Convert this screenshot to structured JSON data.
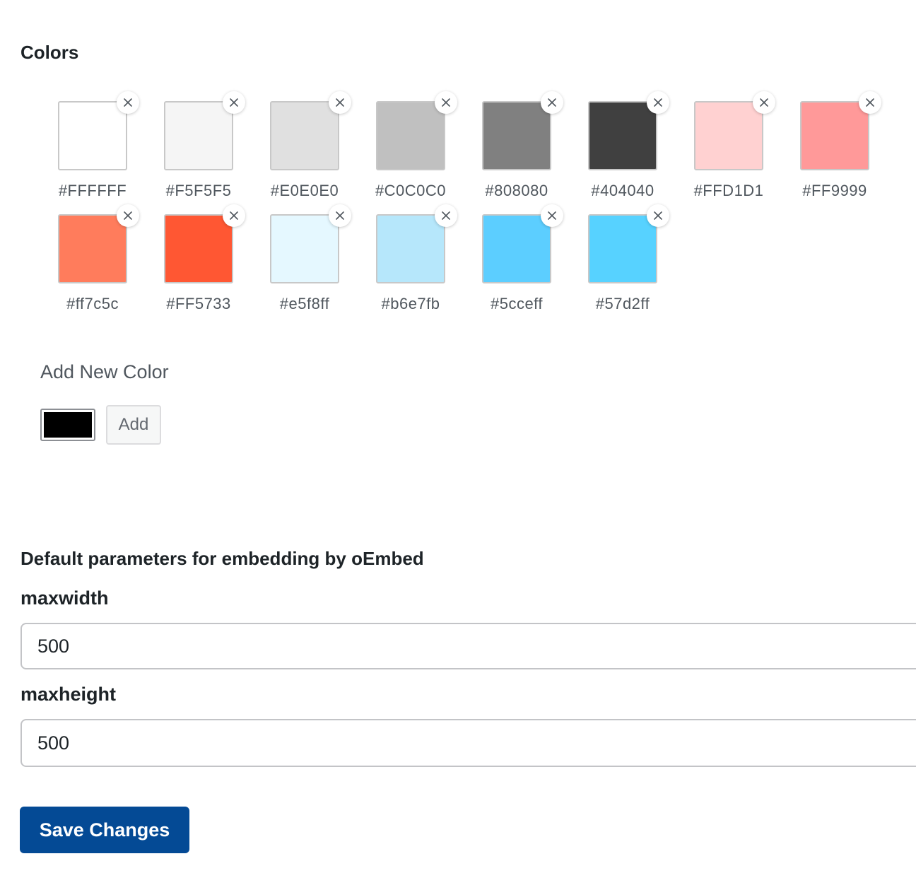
{
  "colors_section": {
    "title": "Colors",
    "swatches": [
      {
        "hex": "#FFFFFF",
        "label": "#FFFFFF"
      },
      {
        "hex": "#F5F5F5",
        "label": "#F5F5F5"
      },
      {
        "hex": "#E0E0E0",
        "label": "#E0E0E0"
      },
      {
        "hex": "#C0C0C0",
        "label": "#C0C0C0"
      },
      {
        "hex": "#808080",
        "label": "#808080"
      },
      {
        "hex": "#404040",
        "label": "#404040"
      },
      {
        "hex": "#FFD1D1",
        "label": "#FFD1D1"
      },
      {
        "hex": "#FF9999",
        "label": "#FF9999"
      },
      {
        "hex": "#ff7c5c",
        "label": "#ff7c5c"
      },
      {
        "hex": "#FF5733",
        "label": "#FF5733"
      },
      {
        "hex": "#e5f8ff",
        "label": "#e5f8ff"
      },
      {
        "hex": "#b6e7fb",
        "label": "#b6e7fb"
      },
      {
        "hex": "#5cceff",
        "label": "#5cceff"
      },
      {
        "hex": "#57d2ff",
        "label": "#57d2ff"
      }
    ],
    "remove_icon": "close-icon"
  },
  "add_color": {
    "title": "Add New Color",
    "picker_value": "#000000",
    "add_label": "Add"
  },
  "oembed_section": {
    "title": "Default parameters for embedding by oEmbed",
    "maxwidth_label": "maxwidth",
    "maxwidth_value": "500",
    "maxheight_label": "maxheight",
    "maxheight_value": "500"
  },
  "save_label": "Save Changes",
  "theme": {
    "primary_button": "#044a95"
  }
}
